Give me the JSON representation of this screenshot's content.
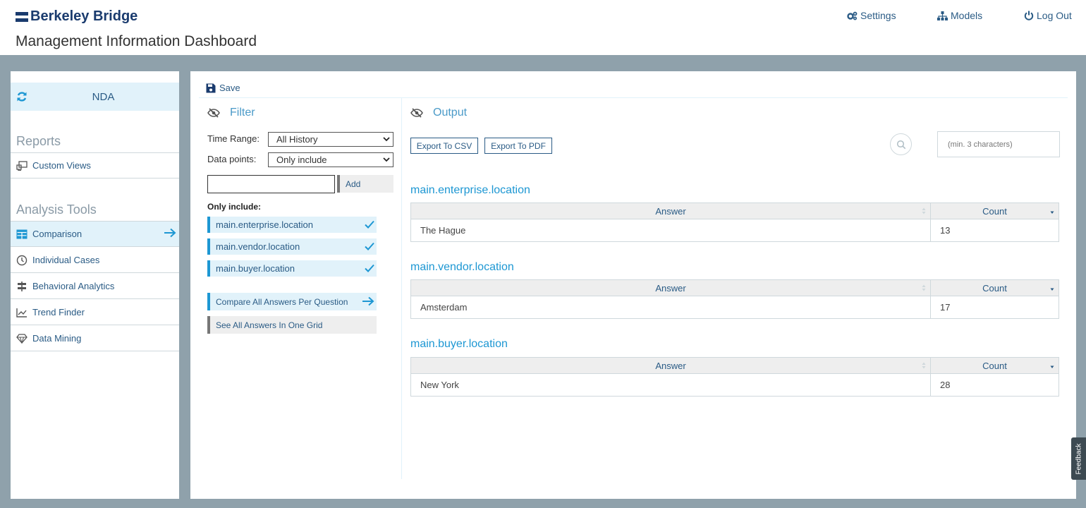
{
  "header": {
    "logo": "Berkeley Bridge",
    "title": "Management Information Dashboard",
    "nav": [
      {
        "label": "Settings",
        "icon": "gears-icon"
      },
      {
        "label": "Models",
        "icon": "sitemap-icon"
      },
      {
        "label": "Log Out",
        "icon": "power-icon"
      }
    ]
  },
  "sidebar": {
    "model": "NDA",
    "reports_title": "Reports",
    "reports": [
      {
        "label": "Custom Views",
        "icon": "custom-views-icon"
      }
    ],
    "tools_title": "Analysis Tools",
    "tools": [
      {
        "label": "Comparison",
        "icon": "table-icon",
        "active": true
      },
      {
        "label": "Individual Cases",
        "icon": "clock-icon"
      },
      {
        "label": "Behavioral Analytics",
        "icon": "signpost-icon"
      },
      {
        "label": "Trend Finder",
        "icon": "chart-line-icon"
      },
      {
        "label": "Data Mining",
        "icon": "diamond-icon"
      }
    ]
  },
  "main": {
    "save_label": "Save",
    "filter": {
      "title": "Filter",
      "time_range_label": "Time Range:",
      "time_range_value": "All History",
      "data_points_label": "Data points:",
      "data_points_value": "Only include",
      "add_input_value": "",
      "add_label": "Add",
      "only_include_label": "Only include:",
      "items": [
        "main.enterprise.location",
        "main.vendor.location",
        "main.buyer.location"
      ],
      "compare_label": "Compare All Answers Per Question",
      "see_all_label": "See All Answers In One Grid"
    },
    "output": {
      "title": "Output",
      "export_csv": "Export To CSV",
      "export_pdf": "Export To PDF",
      "search_placeholder": "(min. 3 characters)",
      "col_answer": "Answer",
      "col_count": "Count",
      "questions": [
        {
          "name": "main.enterprise.location",
          "answer": "The Hague",
          "count": "13"
        },
        {
          "name": "main.vendor.location",
          "answer": "Amsterdam",
          "count": "17"
        },
        {
          "name": "main.buyer.location",
          "answer": "New York",
          "count": "28"
        }
      ]
    }
  },
  "feedback_label": "Feedback",
  "colors": {
    "accent": "#1d97d3",
    "link": "#2a5b85",
    "active_bg": "#e1f2fa",
    "workspace_bg": "#8fa1ab",
    "brand": "#1a3b6e"
  }
}
